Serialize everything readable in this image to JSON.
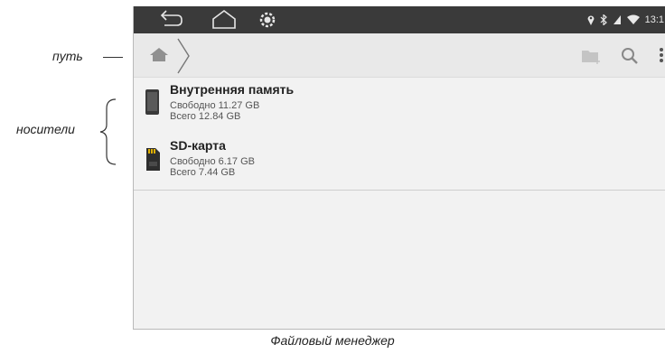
{
  "annotations": {
    "path_label": "путь",
    "media_label": "носители"
  },
  "status_bar": {
    "clock": "13:1",
    "icons": [
      "back-icon",
      "home-icon",
      "settings-icon",
      "location-icon",
      "bluetooth-icon",
      "signal-icon",
      "wifi-icon"
    ]
  },
  "path_bar": {
    "icons": [
      "home-icon",
      "chevron-right-icon",
      "new-folder-icon",
      "search-icon",
      "more-icon"
    ]
  },
  "storage": [
    {
      "name": "Внутренняя память",
      "free": "Свободно 11.27 GB",
      "total": "Всего 12.84 GB",
      "icon": "phone-storage-icon"
    },
    {
      "name": "SD-карта",
      "free": "Свободно 6.17 GB",
      "total": "Всего 7.44 GB",
      "icon": "sd-card-icon"
    }
  ],
  "caption": "Файловый менеджер",
  "colors": {
    "status_bar": "#3a3a3a",
    "path_bar": "#e9e9e9",
    "content": "#f2f2f2"
  }
}
